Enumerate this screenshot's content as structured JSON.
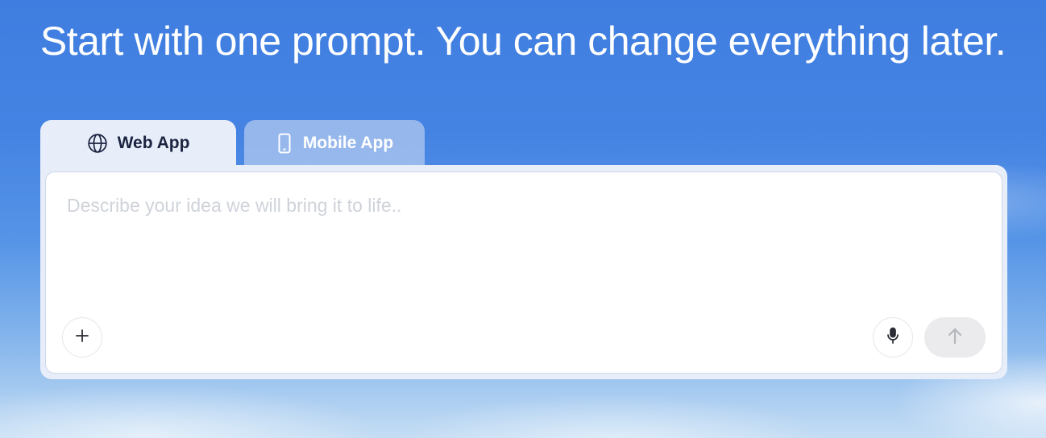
{
  "headline": "Start with one prompt. You can change everything later.",
  "tabs": [
    {
      "label": "Web App",
      "icon": "globe-icon",
      "active": true
    },
    {
      "label": "Mobile App",
      "icon": "smartphone-icon",
      "active": false
    }
  ],
  "prompt": {
    "value": "",
    "placeholder": "Describe your idea we will bring it to life.."
  },
  "actions": {
    "add_icon": "plus-icon",
    "mic_icon": "microphone-icon",
    "send_icon": "arrow-up-icon"
  },
  "colors": {
    "sky_top": "#3f7ee0",
    "active_tab_bg": "#e8eef9",
    "active_tab_text": "#1a2340",
    "placeholder_text": "#cfd3da",
    "send_button_bg": "#ebebee"
  }
}
